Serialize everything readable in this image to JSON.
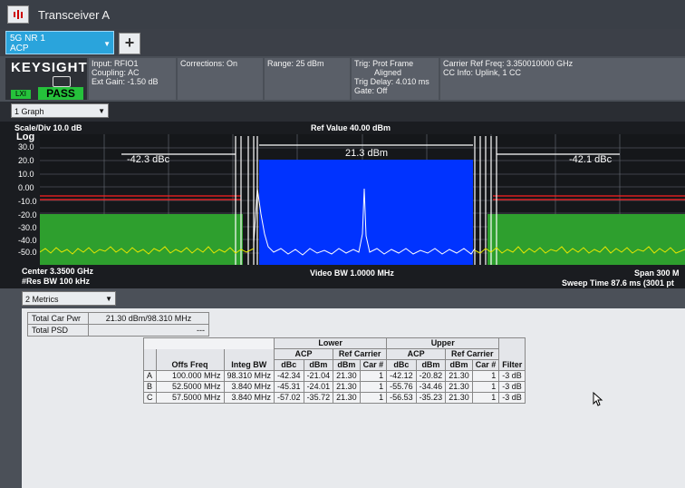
{
  "window": {
    "title": "Transceiver A"
  },
  "mode": {
    "line1": "5G NR 1",
    "line2": "ACP"
  },
  "logo": "KEYSIGHT",
  "status": {
    "pass": "PASS",
    "lxi": "LXI"
  },
  "info": {
    "input": "Input: RFIO1",
    "coupling": "Coupling: AC",
    "ext_gain": "Ext Gain: -1.50 dB",
    "corrections": "Corrections: On",
    "range": "Range: 25 dBm",
    "trig1": "Trig: Prot Frame",
    "trig2": "Aligned",
    "trig_delay": "Trig Delay: 4.010 ms",
    "gate": "Gate: Off",
    "carrier_ref": "Carrier Ref Freq: 3.350010000 GHz",
    "cc_info": "CC Info: Uplink, 1 CC"
  },
  "graph_select": "1 Graph",
  "graph": {
    "scale": "Scale/Div 10.0 dB",
    "ref_value": "Ref Value 40.00 dBm",
    "log": "Log",
    "yticks": [
      "30.0",
      "20.0",
      "10.0",
      "0.00",
      "-10.0",
      "-20.0",
      "-30.0",
      "-40.0",
      "-50.0"
    ],
    "left_dbc": "-42.3 dBc",
    "center_dbm": "21.3 dBm",
    "right_dbc": "-42.1 dBc",
    "center_freq": "Center 3.3500 GHz",
    "res_bw": "#Res BW 100 kHz",
    "video_bw": "Video BW 1.0000 MHz",
    "span": "Span 300 M",
    "sweep": "Sweep Time 87.6 ms  (3001 pt"
  },
  "metrics_select": "2 Metrics",
  "summary": {
    "total_car_pwr_label": "Total Car Pwr",
    "total_car_pwr_value": "21.30 dBm/98.310 MHz",
    "total_psd_label": "Total PSD",
    "total_psd_value": "---"
  },
  "acp_table": {
    "headers": {
      "lower": "Lower",
      "upper": "Upper",
      "offs_freq": "Offs Freq",
      "integ_bw": "Integ BW",
      "acp": "ACP",
      "ref_carrier": "Ref Carrier",
      "dbc": "dBc",
      "dbm": "dBm",
      "car": "Car #",
      "filter": "Filter"
    },
    "rows": [
      {
        "id": "A",
        "offs": "100.000 MHz",
        "bw": "98.310 MHz",
        "l_dbc": "-42.34",
        "l_dbm": "-21.04",
        "l_ref": "21.30",
        "l_car": "1",
        "u_dbc": "-42.12",
        "u_dbm": "-20.82",
        "u_ref": "21.30",
        "u_car": "1",
        "filter": "-3 dB"
      },
      {
        "id": "B",
        "offs": "52.5000 MHz",
        "bw": "3.840 MHz",
        "l_dbc": "-45.31",
        "l_dbm": "-24.01",
        "l_ref": "21.30",
        "l_car": "1",
        "u_dbc": "-55.76",
        "u_dbm": "-34.46",
        "u_ref": "21.30",
        "u_car": "1",
        "filter": "-3 dB"
      },
      {
        "id": "C",
        "offs": "57.5000 MHz",
        "bw": "3.840 MHz",
        "l_dbc": "-57.02",
        "l_dbm": "-35.72",
        "l_ref": "21.30",
        "l_car": "1",
        "u_dbc": "-56.53",
        "u_dbm": "-35.23",
        "u_ref": "21.30",
        "u_car": "1",
        "filter": "-3 dB"
      }
    ]
  },
  "colors": {
    "carrier": "#0033ff",
    "adjacent": "#2e9f2e",
    "trace": "#ffffff",
    "noise": "#e6e600",
    "limit": "#ff2020",
    "pass": "#25c23b",
    "mode": "#2aa4dc"
  }
}
